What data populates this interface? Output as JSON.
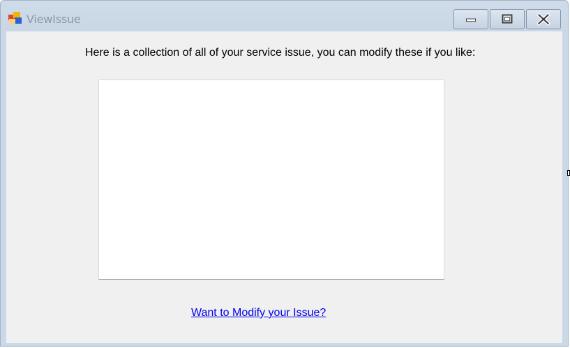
{
  "window": {
    "title": "ViewIssue",
    "icon": "app-window-icon",
    "controls": {
      "minimize": "minimize-icon",
      "maximize": "maximize-icon",
      "close": "close-icon"
    }
  },
  "main": {
    "header_text": "Here is a collection of all of your service issue, you can modify these if you like:",
    "issue_list": {
      "items": []
    },
    "modify_link_label": "Want to Modify your Issue?"
  },
  "colors": {
    "client_background": "#f0f0f0",
    "link": "#0000ee",
    "title_text": "#8a97a6"
  }
}
